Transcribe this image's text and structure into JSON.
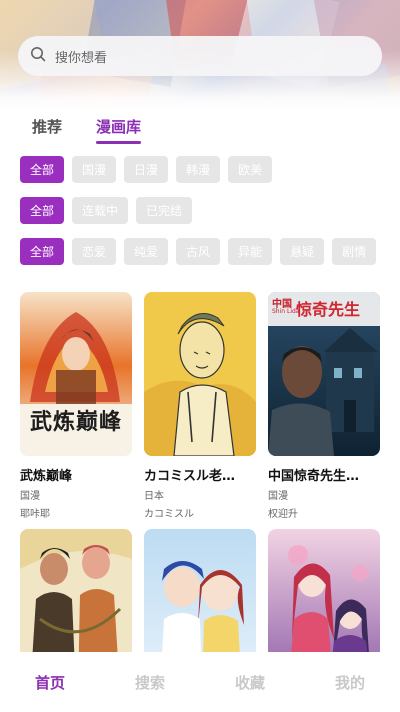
{
  "search": {
    "placeholder": "搜你想看"
  },
  "tabs": [
    {
      "label": "推荐",
      "active": false
    },
    {
      "label": "漫画库",
      "active": true
    }
  ],
  "filters": {
    "region": [
      "全部",
      "国漫",
      "日漫",
      "韩漫",
      "欧美"
    ],
    "status": [
      "全部",
      "连载中",
      "已完结"
    ],
    "genre": [
      "全部",
      "恋爱",
      "纯爱",
      "古风",
      "异能",
      "悬疑",
      "剧情"
    ]
  },
  "comics": [
    {
      "title": "武炼巅峰",
      "region": "国漫",
      "author": "耶咔耶",
      "cover_text": "武炼巅峰"
    },
    {
      "title": "カコミスル老…",
      "region": "日本",
      "author": "カコミスル",
      "cover_text": ""
    },
    {
      "title": "中国惊奇先生…",
      "region": "国漫",
      "author": "权迎升",
      "cover_text": "惊奇先生",
      "cover_small": "中国",
      "cover_small2": "Shin Lida"
    },
    {
      "title": "",
      "region": "",
      "author": "",
      "cover_text": ""
    },
    {
      "title": "",
      "region": "",
      "author": "",
      "cover_text": ""
    },
    {
      "title": "",
      "region": "",
      "author": "",
      "cover_text": ""
    }
  ],
  "bottom_nav": [
    {
      "label": "首页",
      "active": true
    },
    {
      "label": "搜索",
      "active": false
    },
    {
      "label": "收藏",
      "active": false
    },
    {
      "label": "我的",
      "active": false
    }
  ],
  "colors": {
    "accent": "#9a2fbf",
    "chip_inactive": "#e6e6e6"
  }
}
